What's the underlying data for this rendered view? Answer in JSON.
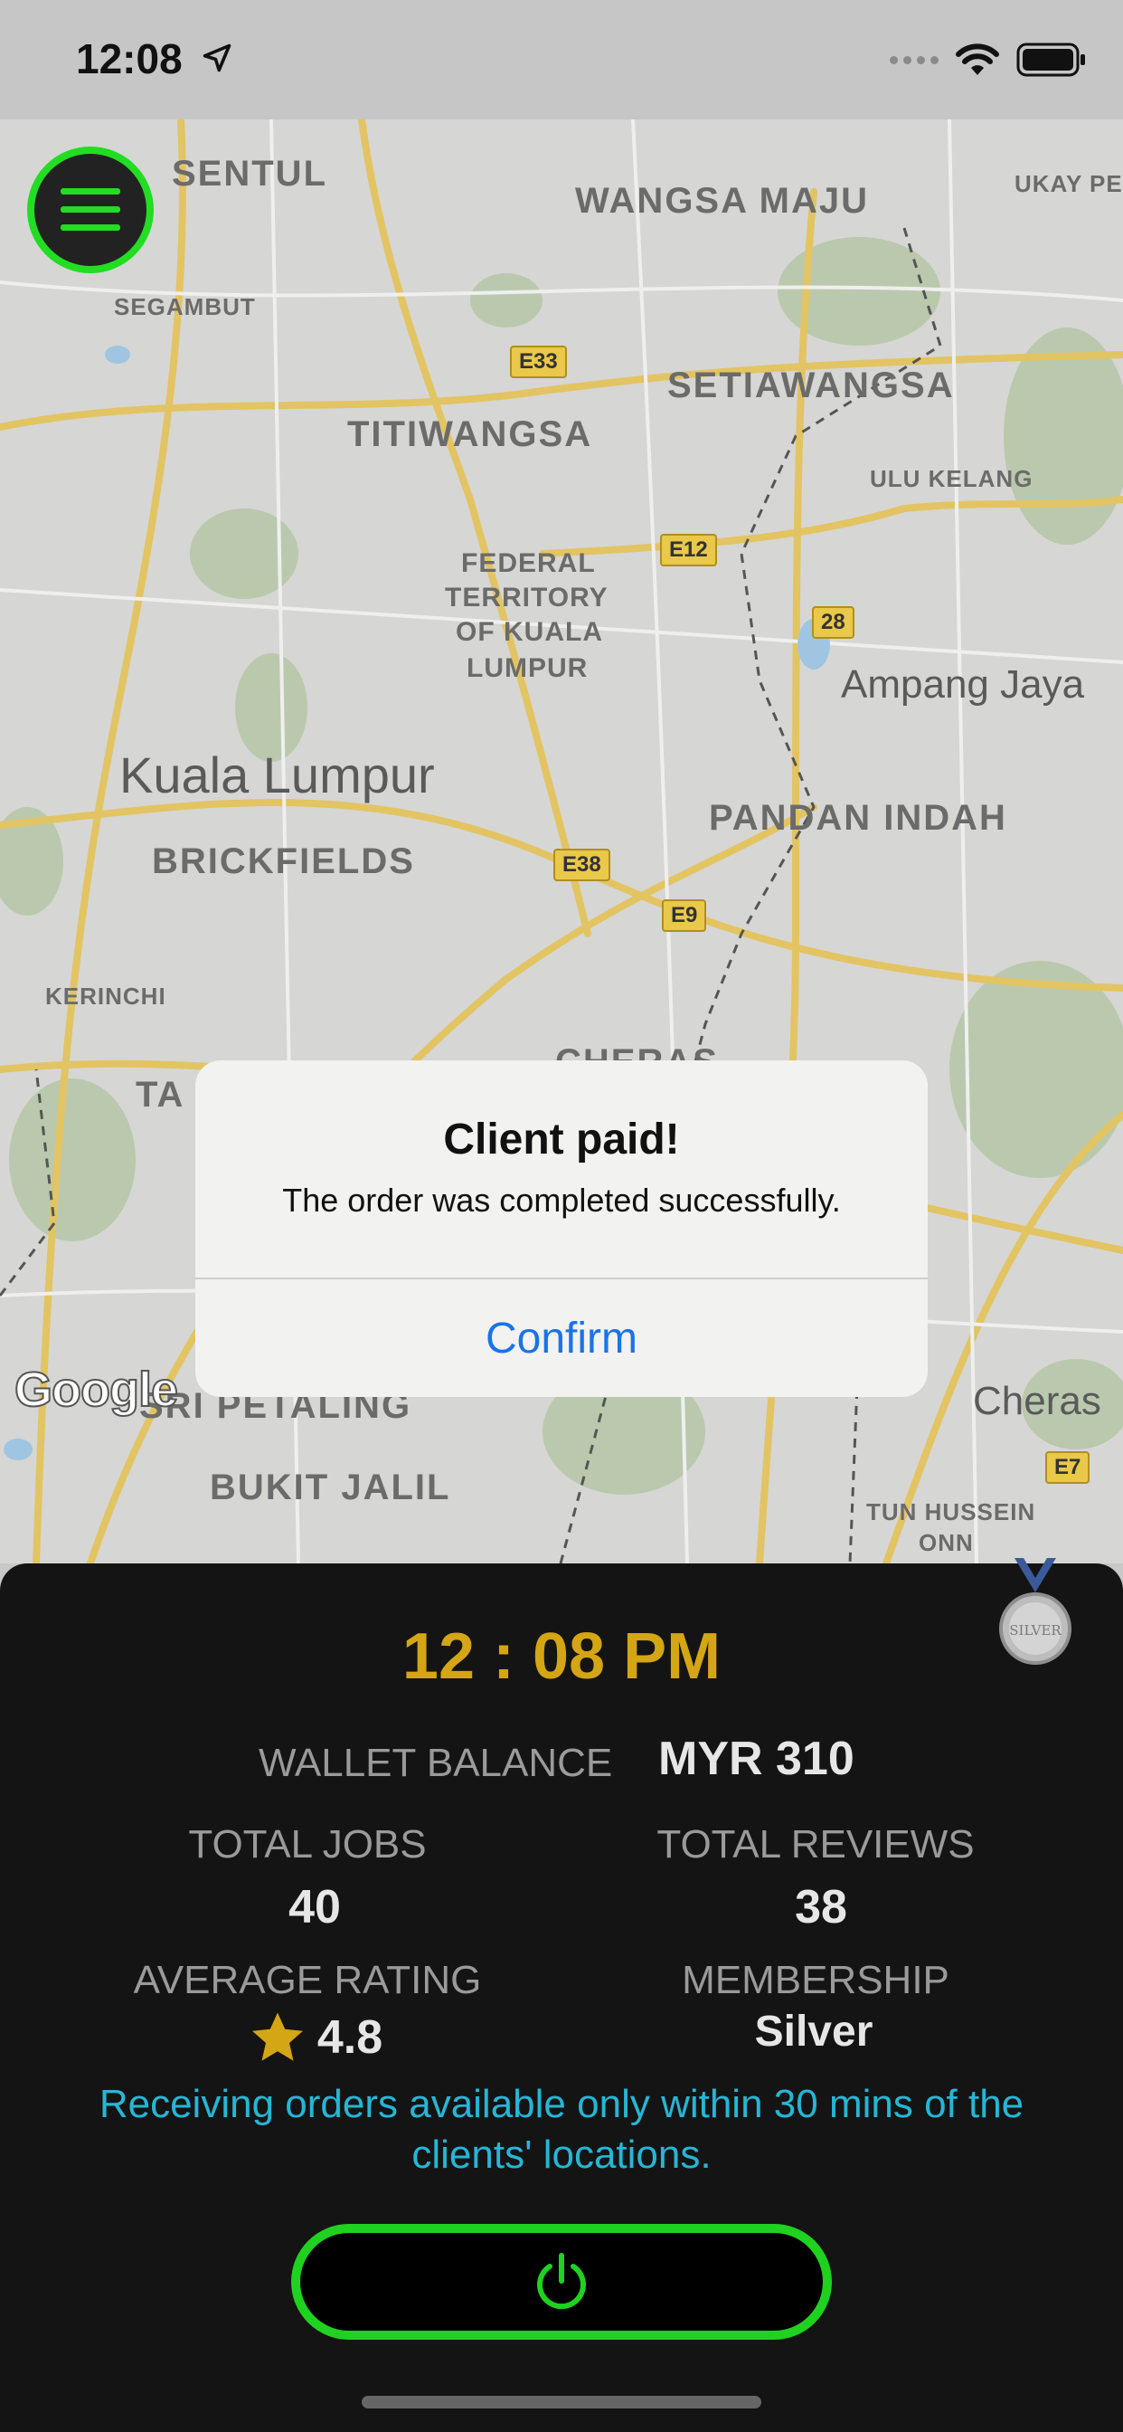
{
  "status_bar": {
    "time": "12:08"
  },
  "map": {
    "labels": {
      "sentul": "SENTUL",
      "wangsa_maju": "WANGSA MAJU",
      "ukay_per": "UKAY PER",
      "segambut": "SEGAMBUT",
      "setiawangsa": "SETIAWANGSA",
      "titiwangsa": "TITIWANGSA",
      "ulu_kelang": "ULU KELANG",
      "federal_1": "FEDERAL",
      "federal_2": "TERRITORY",
      "federal_3": "OF KUALA",
      "federal_4": "LUMPUR",
      "ampang_jaya": "Ampang Jaya",
      "kuala_lumpur": "Kuala Lumpur",
      "pandan_indah": "PANDAN INDAH",
      "brickfields": "BRICKFIELDS",
      "kerinchi": "KERINCHI",
      "cheras_top": "CHERAS",
      "ta": "TA",
      "cheras": "Cheras",
      "sri_petaling": "SRI PETALING",
      "bukit_jalil": "BUKIT JALIL",
      "tun_hussein_1": "TUN HUSSEIN",
      "tun_hussein_2": "ONN"
    },
    "roads": {
      "e33": "E33",
      "e12": "E12",
      "r28": "28",
      "e38": "E38",
      "e9": "E9",
      "e7": "E7"
    },
    "attribution": "Google"
  },
  "dialog": {
    "title": "Client paid!",
    "message": "The order was completed successfully.",
    "confirm_label": "Confirm"
  },
  "panel": {
    "clock": "12 : 08 PM",
    "wallet_label": "WALLET BALANCE",
    "wallet_value": "MYR 310",
    "total_jobs_label": "TOTAL JOBS",
    "total_jobs_value": "40",
    "total_reviews_label": "TOTAL REVIEWS",
    "total_reviews_value": "38",
    "average_rating_label": "AVERAGE RATING",
    "average_rating_value": "4.8",
    "membership_label": "MEMBERSHIP",
    "membership_value": "Silver",
    "medal_text": "SILVER",
    "notice": "Receiving orders available only within 30 mins of the clients' locations."
  },
  "colors": {
    "accent_green": "#1fd21f",
    "clock_gold": "#d4a514",
    "notice_cyan": "#26b6d6",
    "link_blue": "#1a73e8"
  },
  "icons": {
    "menu": "hamburger-icon",
    "power": "power-icon",
    "star": "star-icon",
    "medal": "silver-medal-icon"
  }
}
